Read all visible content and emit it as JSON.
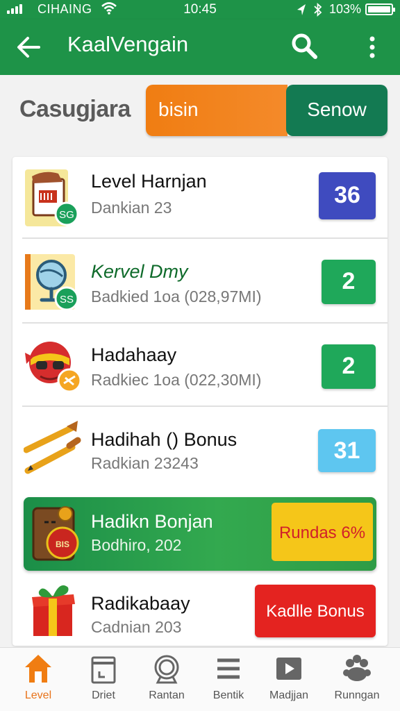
{
  "status_bar": {
    "carrier": "CIHAING",
    "time": "10:45",
    "battery": "103%"
  },
  "app_bar": {
    "title": "KaalVengain"
  },
  "subheader": {
    "label": "Casugjara",
    "tab_left": "bisin",
    "tab_right": "Senow"
  },
  "list": {
    "items": [
      {
        "title": "Level Harnjan",
        "subtitle": "Dankian 23",
        "badge": "36",
        "badge_color": "#3f4bbf"
      },
      {
        "title": "Kervel Dmy",
        "subtitle": "Badkied 1oa (028,97MI)",
        "badge": "2",
        "badge_color": "#1fa85a"
      },
      {
        "title": "Hadahaay",
        "subtitle": "Radkiec 1oa (022,30MI)",
        "badge": "2",
        "badge_color": "#1fa85a"
      },
      {
        "title": "Hadihah () Bonus",
        "subtitle": "Radkian 23243",
        "badge": "31",
        "badge_color": "#5ec6f0"
      }
    ],
    "promo": {
      "title": "Hadikn Bonjan",
      "subtitle": "Bodhiro, 202",
      "button": "Rundas 6%",
      "icon_text": "BIS"
    },
    "last": {
      "title": "Radikabaay",
      "subtitle": "Cadnian 203",
      "button": "Kadlle Bonus"
    },
    "icon_texts": [
      "SG",
      "SS"
    ]
  },
  "bottom_nav": {
    "items": [
      {
        "label": "Level",
        "icon": "home-icon",
        "active": true
      },
      {
        "label": "Driet",
        "icon": "calendar-icon",
        "active": false
      },
      {
        "label": "Rantan",
        "icon": "badge-icon",
        "active": false
      },
      {
        "label": "Bentik",
        "icon": "menu-icon",
        "active": false
      },
      {
        "label": "Madjjan",
        "icon": "play-icon",
        "active": false
      },
      {
        "label": "Runngan",
        "icon": "paw-icon",
        "active": false
      }
    ]
  },
  "colors": {
    "primary": "#1e9348",
    "accent_orange": "#f07d12",
    "dark_green": "#137a52"
  }
}
